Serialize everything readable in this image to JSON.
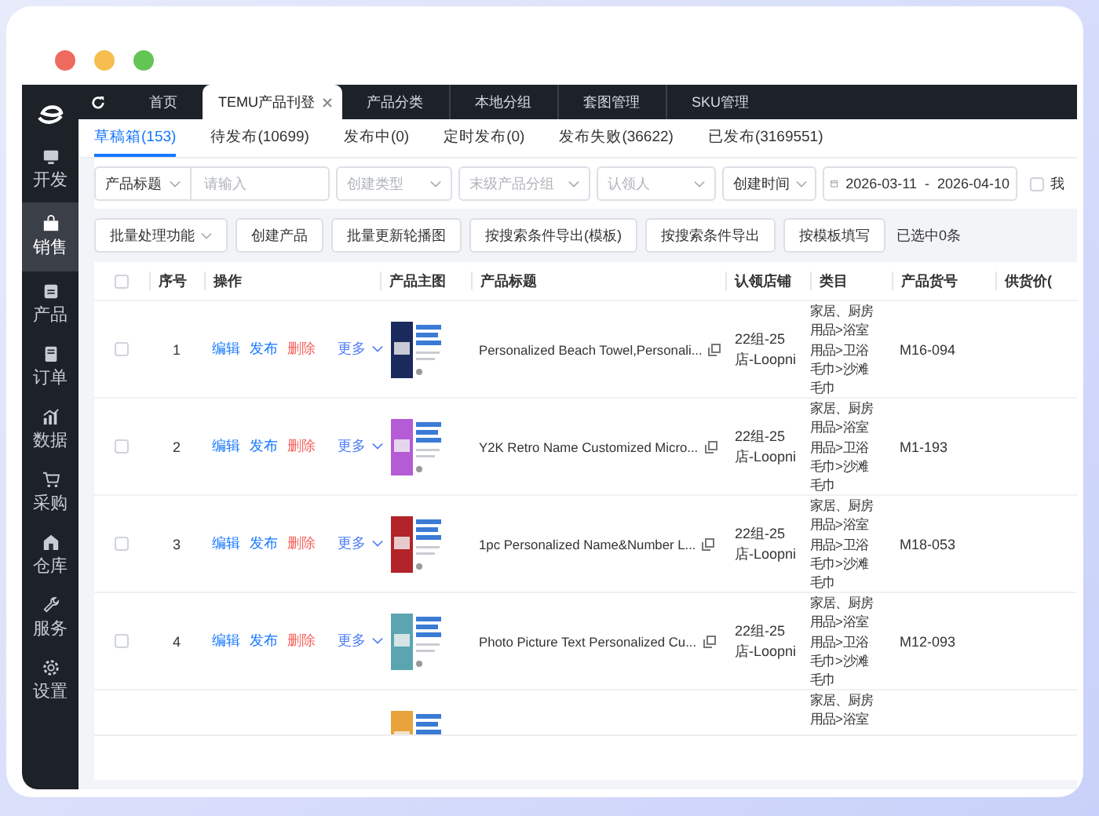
{
  "window_controls": [
    {
      "kind": "close"
    },
    {
      "kind": "minimize"
    },
    {
      "kind": "zoom"
    }
  ],
  "sidebar": {
    "items": [
      {
        "label": "开发",
        "selected": false
      },
      {
        "label": "销售",
        "selected": true
      },
      {
        "label": "产品",
        "selected": false
      },
      {
        "label": "订单",
        "selected": false
      },
      {
        "label": "数据",
        "selected": false
      },
      {
        "label": "采购",
        "selected": false
      },
      {
        "label": "仓库",
        "selected": false
      },
      {
        "label": "服务",
        "selected": false
      },
      {
        "label": "设置",
        "selected": false
      }
    ]
  },
  "tabs": [
    {
      "label": "首页",
      "selected": false,
      "closable": false
    },
    {
      "label": "TEMU产品刊登",
      "selected": true,
      "closable": true
    },
    {
      "label": "产品分类",
      "selected": false,
      "closable": false
    },
    {
      "label": "本地分组",
      "selected": false,
      "closable": false
    },
    {
      "label": "套图管理",
      "selected": false,
      "closable": false
    },
    {
      "label": "SKU管理",
      "selected": false,
      "closable": false
    }
  ],
  "status_tabs": [
    {
      "label": "草稿箱(153)",
      "selected": true
    },
    {
      "label": "待发布(10699)",
      "selected": false
    },
    {
      "label": "发布中(0)",
      "selected": false
    },
    {
      "label": "定时发布(0)",
      "selected": false
    },
    {
      "label": "发布失败(36622)",
      "selected": false
    },
    {
      "label": "已发布(3169551)",
      "selected": false
    }
  ],
  "filters": {
    "search_field": {
      "value": "产品标题",
      "placeholder": "请输入"
    },
    "selects": [
      {
        "placeholder": "创建类型"
      },
      {
        "placeholder": "末级产品分组"
      },
      {
        "placeholder": "认领人"
      }
    ],
    "date_field": {
      "value": "创建时间"
    },
    "date_range": {
      "start": "2026-03-11",
      "separator": "-",
      "end": "2026-04-10"
    },
    "checkbox": {
      "label": "我",
      "checked": false
    }
  },
  "toolbar": {
    "buttons": [
      {
        "label": "批量处理功能",
        "kind": "dropdown"
      },
      {
        "label": "创建产品",
        "kind": "plain"
      },
      {
        "label": "批量更新轮播图",
        "kind": "plain"
      },
      {
        "label": "按搜索条件导出(模板)",
        "kind": "plain"
      },
      {
        "label": "按搜索条件导出",
        "kind": "plain"
      },
      {
        "label": "按模板填写",
        "kind": "plain"
      }
    ],
    "selection_text": "已选中0条"
  },
  "table": {
    "all_checked": false,
    "columns": [
      "序号",
      "操作",
      "产品主图",
      "产品标题",
      "认领店铺",
      "类目",
      "产品货号",
      "供货价("
    ],
    "rows": [
      {
        "checked": false,
        "index": "1",
        "actions": [
          {
            "label": "编辑",
            "kind": "link"
          },
          {
            "label": "发布",
            "kind": "link"
          },
          {
            "label": "删除",
            "kind": "danger"
          },
          {
            "label": "更多",
            "kind": "menu"
          }
        ],
        "title": "Personalized Beach Towel,Personali...",
        "store_lines": [
          "22组-25",
          "店-Loopni"
        ],
        "category_lines": [
          "家居、厨房",
          "用品>浴室",
          "用品>卫浴",
          "毛巾>沙滩",
          "毛巾"
        ],
        "sku": "M16-094"
      },
      {
        "checked": false,
        "index": "2",
        "actions": [
          {
            "label": "编辑",
            "kind": "link"
          },
          {
            "label": "发布",
            "kind": "link"
          },
          {
            "label": "删除",
            "kind": "danger"
          },
          {
            "label": "更多",
            "kind": "menu"
          }
        ],
        "title": "Y2K Retro Name Customized Micro...",
        "store_lines": [
          "22组-25",
          "店-Loopni"
        ],
        "category_lines": [
          "家居、厨房",
          "用品>浴室",
          "用品>卫浴",
          "毛巾>沙滩",
          "毛巾"
        ],
        "sku": "M1-193"
      },
      {
        "checked": false,
        "index": "3",
        "actions": [
          {
            "label": "编辑",
            "kind": "link"
          },
          {
            "label": "发布",
            "kind": "link"
          },
          {
            "label": "删除",
            "kind": "danger"
          },
          {
            "label": "更多",
            "kind": "menu"
          }
        ],
        "title": "1pc Personalized Name&Number L...",
        "store_lines": [
          "22组-25",
          "店-Loopni"
        ],
        "category_lines": [
          "家居、厨房",
          "用品>浴室",
          "用品>卫浴",
          "毛巾>沙滩",
          "毛巾"
        ],
        "sku": "M18-053"
      },
      {
        "checked": false,
        "index": "4",
        "actions": [
          {
            "label": "编辑",
            "kind": "link"
          },
          {
            "label": "发布",
            "kind": "link"
          },
          {
            "label": "删除",
            "kind": "danger"
          },
          {
            "label": "更多",
            "kind": "menu"
          }
        ],
        "title": "Photo Picture Text Personalized Cu...",
        "store_lines": [
          "22组-25",
          "店-Loopni"
        ],
        "category_lines": [
          "家居、厨房",
          "用品>浴室",
          "用品>卫浴",
          "毛巾>沙滩",
          "毛巾"
        ],
        "sku": "M12-093"
      },
      {
        "category_lines": [
          "家居、厨房",
          "用品>浴室"
        ]
      }
    ]
  }
}
